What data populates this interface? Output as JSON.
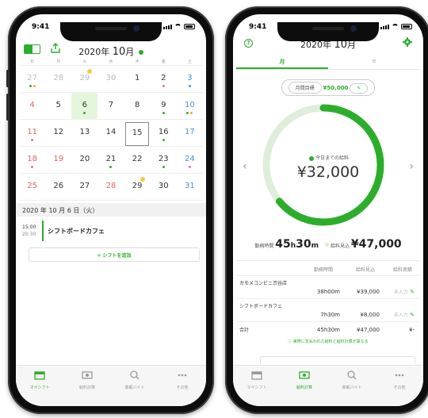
{
  "status": {
    "time": "9:41"
  },
  "left": {
    "header": {
      "year": "2020",
      "year_unit": "年",
      "month": "10",
      "month_unit": "月"
    },
    "weekdays": [
      "日",
      "月",
      "火",
      "水",
      "木",
      "金",
      "土"
    ],
    "calendar": [
      [
        "27",
        "28",
        "29",
        "30",
        "1",
        "2",
        "3"
      ],
      [
        "4",
        "5",
        "6",
        "7",
        "8",
        "9",
        "10"
      ],
      [
        "11",
        "12",
        "13",
        "14",
        "15",
        "16",
        "17"
      ],
      [
        "18",
        "19",
        "20",
        "21",
        "22",
        "23",
        "24"
      ],
      [
        "25",
        "26",
        "27",
        "28",
        "29",
        "30",
        "31"
      ]
    ],
    "date_bar": "2020 年 10 月 6 日（火）",
    "shift": {
      "start": "15:00",
      "end": "20:30",
      "name": "シフトボードカフェ"
    },
    "add_shift_label": "+ シフトを追加",
    "tabs": [
      "マイシフト",
      "給料計算",
      "車載バイト",
      "その他"
    ]
  },
  "right": {
    "header": {
      "year": "2020",
      "year_unit": "年",
      "month": "10",
      "month_unit": "月"
    },
    "tabs": [
      "月",
      "≡"
    ],
    "goal_label": "月間目標",
    "goal_value": "¥50,000",
    "ring_label": "今日までの給料",
    "ring_value": "¥32,000",
    "progress": 0.64,
    "hours_label": "勤務時間",
    "hours_h": "45",
    "hours_m": "30",
    "expected_label": "給料見込",
    "expected_value": "¥47,000",
    "table_headers": [
      "勤務時間",
      "給料見込",
      "給料実績"
    ],
    "jobs": [
      {
        "name": "カモメコンビニ渋谷店",
        "hours": "38h00m",
        "expected": "¥39,000",
        "actual": "未入力"
      },
      {
        "name": "シフトボードカフェ",
        "hours": "7h30m",
        "expected": "¥8,000",
        "actual": "未入力"
      }
    ],
    "total": {
      "label": "合計",
      "hours": "45h30m",
      "expected": "¥47,000",
      "actual": "¥-"
    },
    "note": "実際に支払われた給料と給料計算が異なる",
    "tabbar": [
      "マイシフト",
      "給料計算",
      "車載バイト",
      "その他"
    ]
  },
  "colors": {
    "accent": "#2cae2c",
    "ring_bg": "#dfeeda"
  }
}
